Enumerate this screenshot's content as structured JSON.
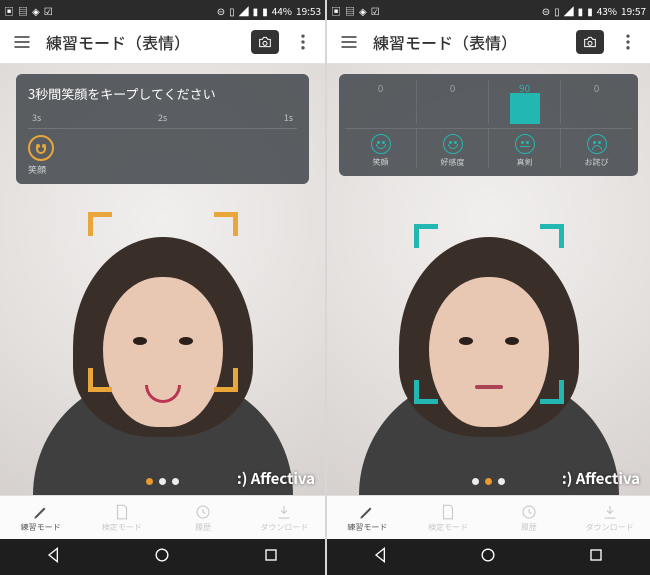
{
  "left": {
    "statusbar": {
      "battery_pct": "44%",
      "time": "19:53"
    },
    "appbar": {
      "title": "練習モード（表情）"
    },
    "overlay": {
      "instruction": "3秒間笑顔をキープしてください",
      "countdown": [
        "3s",
        "2s",
        "1s"
      ],
      "target_label": "笑顔"
    },
    "frame_color": "#e9a63a",
    "dots_active_index": 0,
    "brand": ":) Affectiva",
    "tabs": [
      "練習モード",
      "検定モード",
      "履歴",
      "ダウンロード"
    ]
  },
  "right": {
    "statusbar": {
      "battery_pct": "43%",
      "time": "19:57"
    },
    "appbar": {
      "title": "練習モード（表情）"
    },
    "metrics": {
      "items": [
        {
          "label": "笑顔",
          "value": 0
        },
        {
          "label": "好感度",
          "value": 0
        },
        {
          "label": "真剣",
          "value": 90
        },
        {
          "label": "お詫び",
          "value": 0
        }
      ],
      "max": 100
    },
    "frame_color": "#22b7b0",
    "dots_active_index": 1,
    "brand": ":) Affectiva",
    "tabs": [
      "練習モード",
      "検定モード",
      "履歴",
      "ダウンロード"
    ]
  },
  "chart_data": {
    "type": "bar",
    "categories": [
      "笑顔",
      "好感度",
      "真剣",
      "お詫び"
    ],
    "values": [
      0,
      0,
      90,
      0
    ],
    "title": "",
    "xlabel": "",
    "ylabel": "",
    "ylim": [
      0,
      100
    ]
  }
}
